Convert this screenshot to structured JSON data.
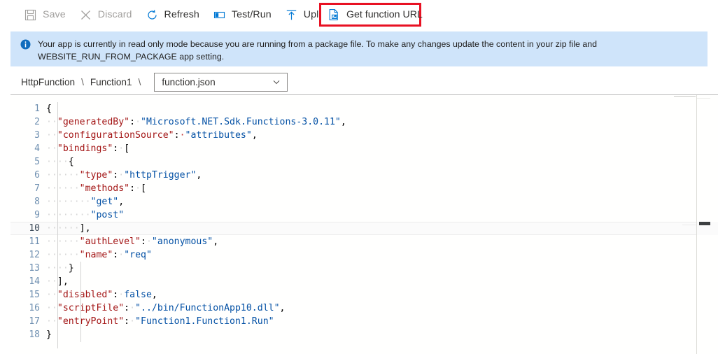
{
  "toolbar": {
    "buttons": [
      {
        "label": "Save",
        "icon": "save-icon",
        "enabled": false
      },
      {
        "label": "Discard",
        "icon": "discard-icon",
        "enabled": false
      },
      {
        "label": "Refresh",
        "icon": "refresh-icon",
        "enabled": true
      },
      {
        "label": "Test/Run",
        "icon": "test-run-icon",
        "enabled": true
      },
      {
        "label": "Upload",
        "icon": "upload-icon",
        "enabled": true
      }
    ],
    "highlighted": {
      "label": "Get function URL",
      "icon": "get-function-url-icon",
      "highlight_color": "#e81123"
    }
  },
  "banner": {
    "icon": "info-icon",
    "accent": "#0078d4",
    "background": "#cfe4fa",
    "text": "Your app is currently in read only mode because you are running from a package file. To make any changes update the content in your zip file and WEBSITE_RUN_FROM_PACKAGE app setting."
  },
  "breadcrumb": {
    "items": [
      "HttpFunction",
      "Function1"
    ],
    "separator": "\\",
    "file_select": {
      "value": "function.json",
      "chevron": "chevron-down-icon"
    }
  },
  "editor": {
    "language": "json",
    "active_line": 10,
    "colors": {
      "key": "#a31515",
      "string": "#0451a5",
      "keyword": "#0451a5",
      "punctuation": "#000000",
      "line_number": "#6e8fb0"
    },
    "lines": [
      {
        "n": 1,
        "text": "{"
      },
      {
        "n": 2,
        "text": "  \"generatedBy\": \"Microsoft.NET.Sdk.Functions-3.0.11\","
      },
      {
        "n": 3,
        "text": "  \"configurationSource\": \"attributes\","
      },
      {
        "n": 4,
        "text": "  \"bindings\": ["
      },
      {
        "n": 5,
        "text": "    {"
      },
      {
        "n": 6,
        "text": "      \"type\": \"httpTrigger\","
      },
      {
        "n": 7,
        "text": "      \"methods\": ["
      },
      {
        "n": 8,
        "text": "        \"get\","
      },
      {
        "n": 9,
        "text": "        \"post\""
      },
      {
        "n": 10,
        "text": "      ],"
      },
      {
        "n": 11,
        "text": "      \"authLevel\": \"anonymous\","
      },
      {
        "n": 12,
        "text": "      \"name\": \"req\""
      },
      {
        "n": 13,
        "text": "    }"
      },
      {
        "n": 14,
        "text": "  ],"
      },
      {
        "n": 15,
        "text": "  \"disabled\": false,"
      },
      {
        "n": 16,
        "text": "  \"scriptFile\": \"../bin/FunctionApp10.dll\","
      },
      {
        "n": 17,
        "text": "  \"entryPoint\": \"Function1.Function1.Run\""
      },
      {
        "n": 18,
        "text": "}"
      }
    ]
  }
}
